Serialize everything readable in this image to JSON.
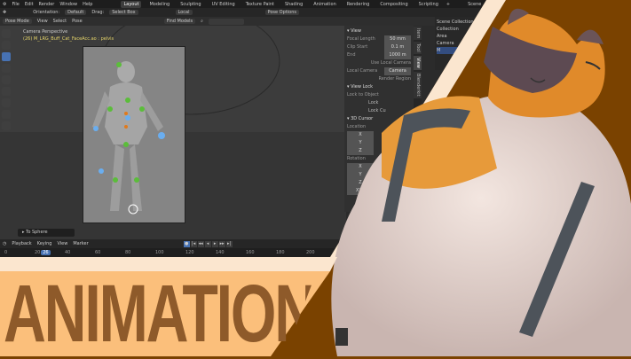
{
  "menu": [
    "File",
    "Edit",
    "Render",
    "Window",
    "Help"
  ],
  "workspaces": [
    "Layout",
    "Modeling",
    "Sculpting",
    "UV Editing",
    "Texture Paint",
    "Shading",
    "Animation",
    "Rendering",
    "Compositing",
    "Scripting"
  ],
  "active_workspace": "Layout",
  "scene": "Scene",
  "view_layer": "View Layer",
  "toolheader": {
    "orientation_label": "Orientation:",
    "orientation": "Default",
    "drag_label": "Drag:",
    "drag": "Select Box",
    "pivot": "Local",
    "pose_options": "Pose Options"
  },
  "viewport_header": {
    "mode": "Pose Mode",
    "view": "View",
    "select": "Select",
    "pose": "Pose",
    "find_models": "Find Models"
  },
  "viewport_info": {
    "camera": "Camera Perspective",
    "object": "(26) M_LRG_Buff_Cat_FaceAcc.ao : pelvis"
  },
  "operator_panel": "To Sphere",
  "npanel": {
    "view_header": "View",
    "focal_length_label": "Focal Length",
    "focal_length": "50 mm",
    "clip_start_label": "Clip Start",
    "clip_start": "0.1 m",
    "end_label": "End",
    "end": "1000 m",
    "use_local_camera": "Use Local Camera",
    "local_camera_label": "Local Camera",
    "local_camera": "Camera",
    "render_region": "Render Region",
    "view_lock_header": "View Lock",
    "lock_to_object": "Lock to Object",
    "lock": "Lock",
    "lock_cursor": "Lock Cu",
    "cursor_header": "3D Cursor",
    "location": "Location",
    "rotation": "Rotation",
    "axes": [
      "X",
      "Y",
      "Z"
    ],
    "rot_mode": "XYZ",
    "tabs": [
      "Item",
      "Tool",
      "View",
      "Blenderkit"
    ]
  },
  "outliner": {
    "root": "Scene Collection",
    "items": [
      "Collection",
      "Area",
      "Camera",
      "M"
    ]
  },
  "timeline": {
    "menus": [
      "Playback",
      "Keying",
      "View",
      "Marker"
    ],
    "ticks": [
      "0",
      "20",
      "40",
      "60",
      "80",
      "100",
      "120",
      "140",
      "160",
      "180",
      "200"
    ],
    "current_frame": "26"
  },
  "title": "ANIMATION",
  "colors": {
    "brand_brown": "#7a4200",
    "title_text": "#8e5a2a",
    "title_band": "#fbbf7b",
    "stripe": "#fbe6cf",
    "accent": "#4772b3"
  }
}
